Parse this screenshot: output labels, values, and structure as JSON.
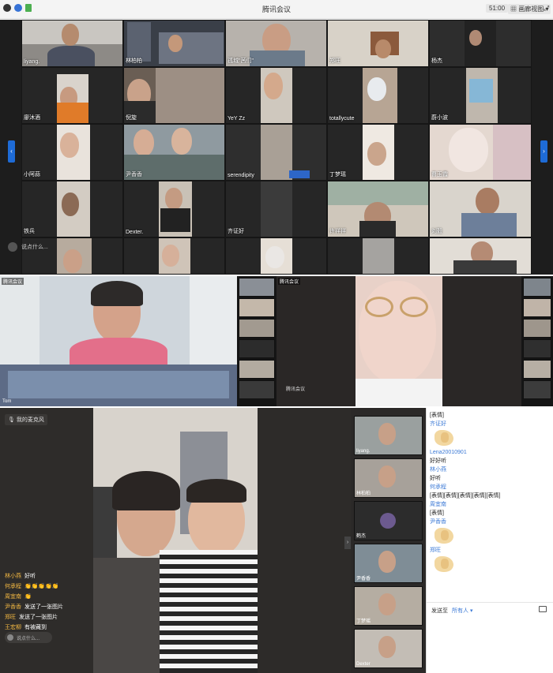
{
  "window": {
    "title": "腾讯会议",
    "time": "51:00",
    "view_label": "画廊视图",
    "fullscreen_icon": "expand-icon"
  },
  "panel1": {
    "participants": [
      "liyang.",
      "林柏柏",
      "孤城\"茜们\"",
      "郑旺",
      "杨杰",
      "廖沐酒",
      "倪旋",
      "YeY Zz",
      "totallycute",
      "蔚小波",
      "小阿蒜",
      "尹香香",
      "serendipity",
      "丁梦瑶",
      "曹玉霞",
      "铁兵",
      "Dexter.",
      "齐证好",
      "许祥祥",
      "刘毅"
    ],
    "speaker_prompt": "说点什么..."
  },
  "panel2": {
    "left_tag": "腾讯会议",
    "right_tag": "腾讯会议",
    "left_name": "Tom",
    "right_name": "腾讯会议"
  },
  "panel3": {
    "mic_label": "我的麦克风",
    "chat_overlay": [
      {
        "name": "林小燕",
        "text": "好听"
      },
      {
        "name": "何承程",
        "text": "👏👏👏👏👏"
      },
      {
        "name": "周宜南",
        "text": "👏"
      },
      {
        "name": "尹香香",
        "text": "发送了一张图片"
      },
      {
        "name": "郑旺",
        "text": "发送了一张图片"
      },
      {
        "name": "王宏柳",
        "text": "有被藏到"
      }
    ],
    "input_placeholder": "说点什么...",
    "strip": [
      "liyang.",
      "林柏柏",
      "鹤杰",
      "尹香香",
      "丁梦瑶",
      "Dexter"
    ],
    "chat": [
      {
        "kind": "text",
        "text": "[表情]"
      },
      {
        "kind": "name",
        "text": "齐证好"
      },
      {
        "kind": "emoji"
      },
      {
        "kind": "name",
        "text": "Lena20010901"
      },
      {
        "kind": "text",
        "text": "好好听"
      },
      {
        "kind": "name",
        "text": "林小燕"
      },
      {
        "kind": "text",
        "text": "好听"
      },
      {
        "kind": "name",
        "text": "何承程"
      },
      {
        "kind": "text",
        "text": "[表情][表情][表情][表情][表情]"
      },
      {
        "kind": "name",
        "text": "周宜南"
      },
      {
        "kind": "text",
        "text": "[表情]"
      },
      {
        "kind": "name",
        "text": "尹香香"
      },
      {
        "kind": "emoji"
      },
      {
        "kind": "name",
        "text": "郑旺"
      },
      {
        "kind": "emoji"
      }
    ],
    "send_to_label": "发送至",
    "send_to_value": "所有人 ▾"
  }
}
